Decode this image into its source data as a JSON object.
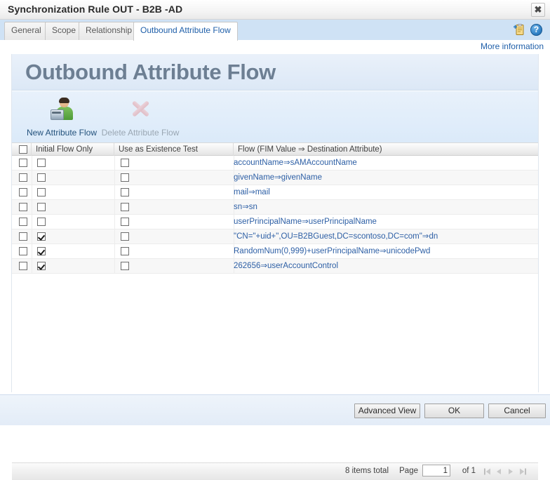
{
  "window": {
    "title": "Synchronization Rule OUT - B2B -AD",
    "close_label": "✖"
  },
  "tabs": [
    {
      "label": "General",
      "active": false
    },
    {
      "label": "Scope",
      "active": false
    },
    {
      "label": "Relationship",
      "active": false
    },
    {
      "label": "Outbound Attribute Flow",
      "active": true
    }
  ],
  "tab_icons": {
    "new_copy": "new-copy-icon",
    "help": "?"
  },
  "links": {
    "more_information": "More information"
  },
  "page": {
    "title": "Outbound Attribute Flow"
  },
  "toolbar": {
    "new_attribute_flow": "New Attribute Flow",
    "delete_attribute_flow": "Delete Attribute Flow",
    "delete_disabled": true
  },
  "grid": {
    "columns": [
      {
        "key": "select",
        "label": ""
      },
      {
        "key": "initial_flow_only",
        "label": "Initial Flow Only"
      },
      {
        "key": "use_as_existence_test",
        "label": "Use as Existence Test"
      },
      {
        "key": "flow",
        "label": "Flow (FIM Value ⇒ Destination Attribute)"
      }
    ],
    "header_select_all": false,
    "rows": [
      {
        "select": false,
        "initial_flow_only": false,
        "use_as_existence_test": false,
        "flow": "accountName⇒sAMAccountName"
      },
      {
        "select": false,
        "initial_flow_only": false,
        "use_as_existence_test": false,
        "flow": "givenName⇒givenName"
      },
      {
        "select": false,
        "initial_flow_only": false,
        "use_as_existence_test": false,
        "flow": "mail⇒mail"
      },
      {
        "select": false,
        "initial_flow_only": false,
        "use_as_existence_test": false,
        "flow": "sn⇒sn"
      },
      {
        "select": false,
        "initial_flow_only": false,
        "use_as_existence_test": false,
        "flow": "userPrincipalName⇒userPrincipalName"
      },
      {
        "select": false,
        "initial_flow_only": true,
        "use_as_existence_test": false,
        "flow": "\"CN=\"+uid+\",OU=B2BGuest,DC=scontoso,DC=com\"⇒dn"
      },
      {
        "select": false,
        "initial_flow_only": true,
        "use_as_existence_test": false,
        "flow": "RandomNum(0,999)+userPrincipalName⇒unicodePwd"
      },
      {
        "select": false,
        "initial_flow_only": true,
        "use_as_existence_test": false,
        "flow": "262656⇒userAccountControl"
      }
    ]
  },
  "pager": {
    "items_total": "8 items total",
    "page_label": "Page",
    "page_value": "1",
    "of_label": "of 1",
    "first_icon": "first-page-icon",
    "prev_icon": "previous-page-icon",
    "next_icon": "next-page-icon",
    "last_icon": "last-page-icon"
  },
  "buttons": {
    "advanced_view": "Advanced View",
    "ok": "OK",
    "cancel": "Cancel"
  },
  "colors": {
    "accent_link": "#2d5fa5",
    "tab_strip": "#cfe2f5",
    "heading": "#6d7f93",
    "toolbar_bg": "#e1ebf8"
  }
}
